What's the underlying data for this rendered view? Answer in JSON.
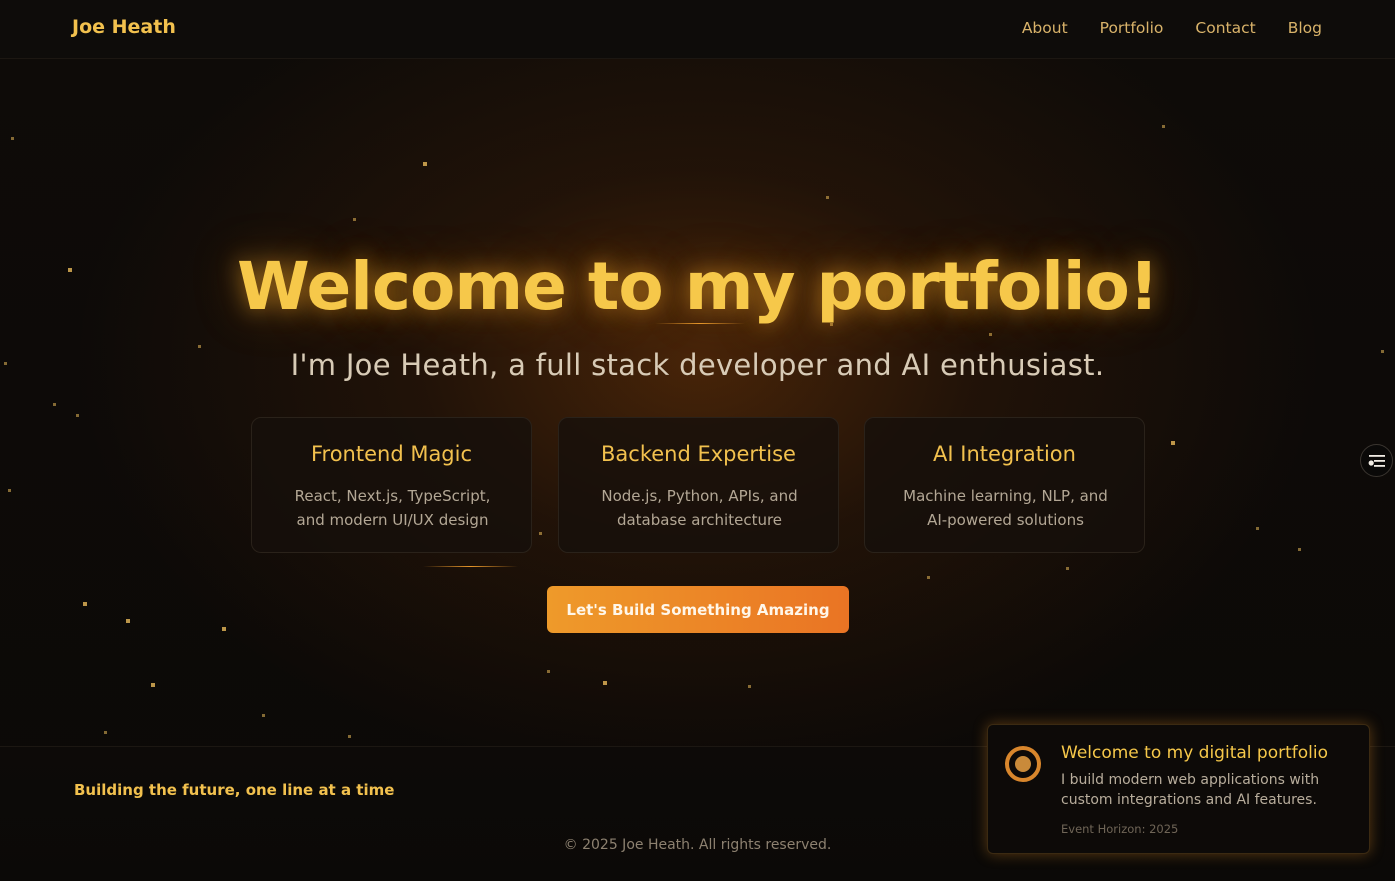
{
  "header": {
    "brand": "Joe Heath",
    "nav": [
      "About",
      "Portfolio",
      "Contact",
      "Blog"
    ]
  },
  "hero": {
    "title": "Welcome to my portfolio!",
    "subtitle": "I'm Joe Heath, a full stack developer and AI enthusiast.",
    "cards": [
      {
        "title": "Frontend Magic",
        "description": "React, Next.js, TypeScript, and modern UI/UX design"
      },
      {
        "title": "Backend Expertise",
        "description": "Node.js, Python, APIs, and database architecture"
      },
      {
        "title": "AI Integration",
        "description": "Machine learning, NLP, and AI-powered solutions"
      }
    ],
    "cta_label": "Let's Build Something Amazing"
  },
  "footer": {
    "tagline": "Building the future, one line at a time",
    "copyright": "© 2025 Joe Heath. All rights reserved."
  },
  "toast": {
    "title": "Welcome to my digital portfolio",
    "body": "I build modern web applications with custom integrations and AI features.",
    "meta": "Event Horizon: 2025"
  },
  "side_widget": {
    "icon": "settings-sliders-icon"
  },
  "colors": {
    "accent": "#f2c14e",
    "cta_start": "#ee9a2a",
    "cta_end": "#ea7424",
    "background": "#0b0907"
  }
}
